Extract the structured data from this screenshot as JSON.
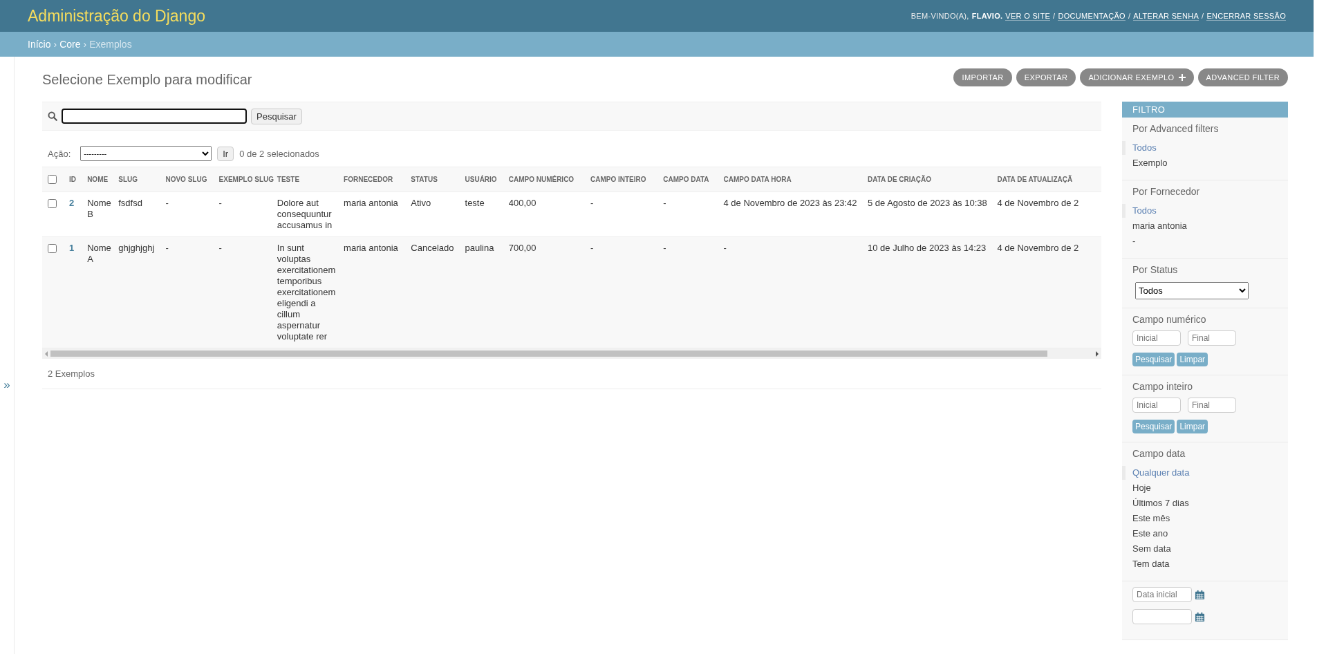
{
  "header": {
    "title": "Administração do Django",
    "welcome": "BEM-VINDO(A),",
    "user": "FLAVIO.",
    "separator": "/",
    "links": [
      "VER O SITE",
      "DOCUMENTAÇÃO",
      "ALTERAR SENHA",
      "ENCERRAR SESSÃO"
    ]
  },
  "breadcrumb_separator": "›",
  "breadcrumbs": [
    {
      "label": "Início",
      "current": false
    },
    {
      "label": "Core",
      "current": false
    },
    {
      "label": "Exemplos",
      "current": true
    }
  ],
  "nav_toggle": "»",
  "page_title": "Selecione Exemplo para modificar",
  "object_tools": [
    {
      "label": "IMPORTAR",
      "kind": "plain"
    },
    {
      "label": "EXPORTAR",
      "kind": "plain"
    },
    {
      "label": "ADICIONAR EXEMPLO",
      "kind": "add"
    },
    {
      "label": "ADVANCED FILTER",
      "kind": "plain"
    }
  ],
  "search": {
    "button": "Pesquisar"
  },
  "actions": {
    "label": "Ação:",
    "value": "---------",
    "button": "Ir",
    "counter": "0 de 2 selecionados"
  },
  "table": {
    "select_all_checked": false,
    "columns": [
      "ID",
      "NOME",
      "SLUG",
      "NOVO SLUG",
      "EXEMPLO SLUG",
      "TESTE",
      "FORNECEDOR",
      "STATUS",
      "USUÁRIO",
      "CAMPO NUMÉRICO",
      "CAMPO INTEIRO",
      "CAMPO DATA",
      "CAMPO DATA HORA",
      "DATA DE CRIAÇÃO",
      "DATA DE ATUALIZAÇÃ"
    ],
    "rows": [
      {
        "checked": false,
        "cells": [
          "2",
          "Nome B",
          "fsdfsd",
          "-",
          "-",
          "Dolore aut consequuntur accusamus in",
          "maria antonia",
          "Ativo",
          "teste",
          "400,00",
          "-",
          "-",
          "4 de Novembro de 2023 às 23:42",
          "5 de Agosto de 2023 às 10:38",
          "4 de Novembro de 2"
        ]
      },
      {
        "checked": false,
        "cells": [
          "1",
          "Nome A",
          "ghjghjghj",
          "-",
          "-",
          "In sunt voluptas exercitationem temporibus exercitationem eligendi a cillum aspernatur voluptate rer",
          "maria antonia",
          "Cancelado",
          "paulina",
          "700,00",
          "-",
          "-",
          "-",
          "10 de Julho de 2023 às 14:23",
          "4 de Novembro de 2"
        ]
      }
    ]
  },
  "paginator": "2 Exemplos",
  "filter": {
    "title": "FILTRO",
    "sections": [
      {
        "kind": "links",
        "title": "Por Advanced filters",
        "items": [
          {
            "label": "Todos",
            "selected": true
          },
          {
            "label": "Exemplo",
            "selected": false
          }
        ]
      },
      {
        "kind": "links",
        "title": "Por Fornecedor",
        "items": [
          {
            "label": "Todos",
            "selected": true
          },
          {
            "label": "maria antonia",
            "selected": false
          },
          {
            "label": "-",
            "selected": false
          }
        ]
      },
      {
        "kind": "select",
        "title": "Por Status",
        "value": "Todos"
      },
      {
        "kind": "range",
        "title": "Campo numérico",
        "fields": [
          {
            "placeholder": "Inicial"
          },
          {
            "placeholder": "Final"
          }
        ],
        "buttons": [
          "Pesquisar",
          "Limpar"
        ]
      },
      {
        "kind": "range",
        "title": "Campo inteiro",
        "fields": [
          {
            "placeholder": "Inicial"
          },
          {
            "placeholder": "Final"
          }
        ],
        "buttons": [
          "Pesquisar",
          "Limpar"
        ]
      },
      {
        "kind": "links",
        "title": "Campo data",
        "items": [
          {
            "label": "Qualquer data",
            "selected": true
          },
          {
            "label": "Hoje",
            "selected": false
          },
          {
            "label": "Últimos 7 dias",
            "selected": false
          },
          {
            "label": "Este mês",
            "selected": false
          },
          {
            "label": "Este ano",
            "selected": false
          },
          {
            "label": "Sem data",
            "selected": false
          },
          {
            "label": "Tem data",
            "selected": false
          }
        ]
      },
      {
        "kind": "dates",
        "fields": [
          {
            "placeholder": "Data inicial",
            "calendar": true
          },
          {
            "calendar": true
          }
        ]
      }
    ]
  }
}
